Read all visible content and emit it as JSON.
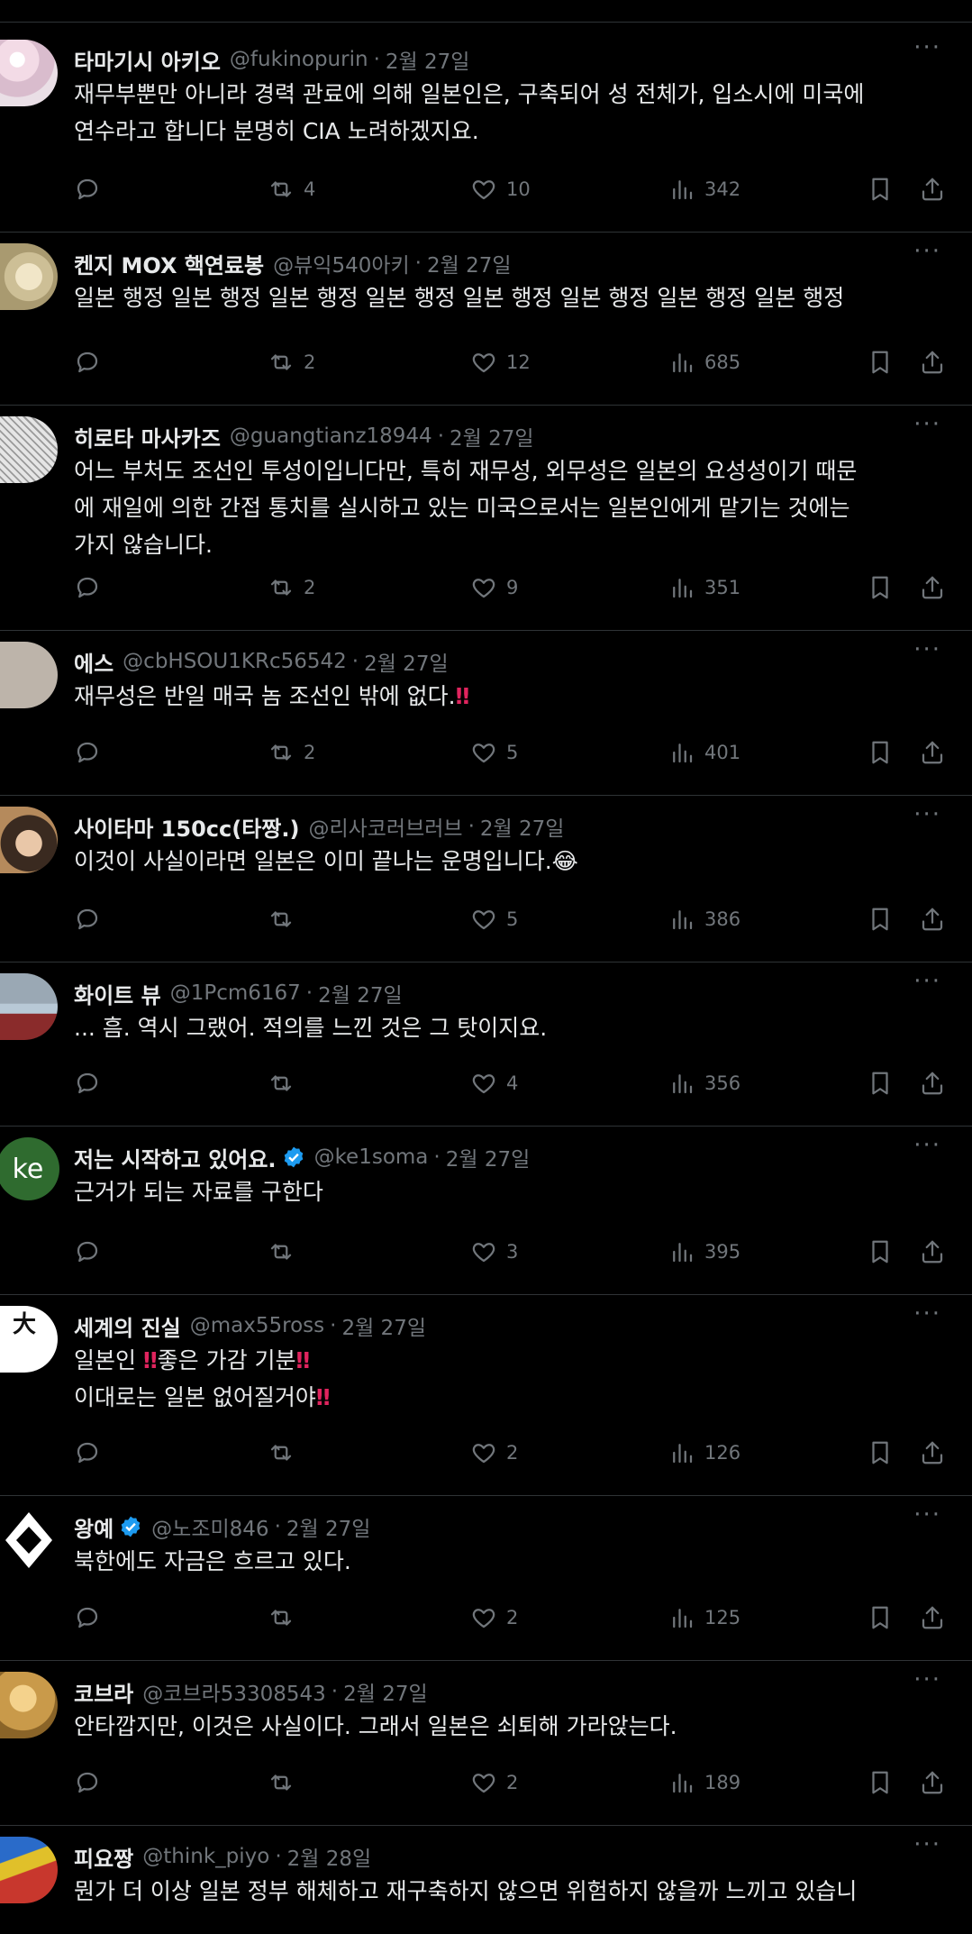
{
  "tweets": [
    {
      "name": "타마기시 아키오",
      "handle": "@fukinopurin",
      "date": "2월 27일",
      "verified": false,
      "lines": [
        "재무부뿐만 아니라 경력 관료에 의해 일본인은, 구축되어 성 전체가, 입소시에 미국에",
        "연수라고 합니다 분명히 CIA 노려하겠지요."
      ],
      "replies": "",
      "retweets": "4",
      "likes": "10",
      "views": "342",
      "avatar": {
        "type": "blossom",
        "color": "#e8d6df"
      }
    },
    {
      "name": "켄지 MOX 핵연료봉",
      "handle": "@뷰익540아키",
      "date": "2월 27일",
      "verified": false,
      "lines": [
        "일본 행정 일본 행정 일본 행정 일본 행정 일본 행정 일본 행정 일본 행정 일본 행정"
      ],
      "replies": "",
      "retweets": "2",
      "likes": "12",
      "views": "685",
      "avatar": {
        "type": "food",
        "color": "#d9cdb0"
      }
    },
    {
      "name": "히로타 마사카즈",
      "handle": "@guangtianz18944",
      "date": "2월 27일",
      "verified": false,
      "lines": [
        "어느 부처도 조선인 투성이입니다만, 특히 재무성, 외무성은 일본의 요성성이기 때문",
        "에 재일에 의한 간접 통치를 실시하고 있는 미국으로서는 일본인에게 맡기는 것에는",
        "가지 않습니다."
      ],
      "replies": "",
      "retweets": "2",
      "likes": "9",
      "views": "351",
      "avatar": {
        "type": "sketch",
        "color": "#cfcfcf"
      }
    },
    {
      "name": "에스",
      "handle": "@cbHSOU1KRc56542",
      "date": "2월 27일",
      "verified": false,
      "lines": [
        "재무성은 반일 매국 놈 조선인 밖에 없다.‼"
      ],
      "replies": "",
      "retweets": "2",
      "likes": "5",
      "views": "401",
      "avatar": {
        "type": "plain",
        "color": "#bdb7b0"
      }
    },
    {
      "name": "사이타마 150cc(타짱.)",
      "handle": "@리사코러브러브",
      "date": "2월 27일",
      "verified": false,
      "lines": [
        "이것이 사실이라면 일본은 이미 끝나는 운명입니다.😂"
      ],
      "replies": "",
      "retweets": "",
      "likes": "5",
      "views": "386",
      "avatar": {
        "type": "face",
        "color": "#6b5545"
      }
    },
    {
      "name": "화이트 뷰",
      "handle": "@1Pcm6167",
      "date": "2월 27일",
      "verified": false,
      "lines": [
        "... 흠. 역시 그랬어. 적의를 느낀 것은 그 탓이지요."
      ],
      "replies": "",
      "retweets": "",
      "likes": "4",
      "views": "356",
      "avatar": {
        "type": "bird",
        "color": "#8b3a3a"
      }
    },
    {
      "name": "저는 시작하고 있어요.",
      "handle": "@ke1soma",
      "date": "2월 27일",
      "verified": true,
      "lines": [
        "근거가 되는 자료를 구한다"
      ],
      "replies": "",
      "retweets": "",
      "likes": "3",
      "views": "395",
      "avatar": {
        "type": "initials",
        "color": "#2f6b2f",
        "text": "ke"
      }
    },
    {
      "name": "세계의 진실",
      "handle": "@max55ross",
      "date": "2월 27일",
      "verified": false,
      "lines": [
        "일본인 ‼좋은 가감 기분‼",
        "이대로는 일본 없어질거야‼"
      ],
      "replies": "",
      "retweets": "",
      "likes": "2",
      "views": "126",
      "avatar": {
        "type": "calligraphy",
        "color": "#ffffff"
      }
    },
    {
      "name": "왕예",
      "handle": "@노조미846",
      "date": "2월 27일",
      "verified": true,
      "lines": [
        "북한에도 자금은 흐르고 있다."
      ],
      "replies": "",
      "retweets": "",
      "likes": "2",
      "views": "125",
      "avatar": {
        "type": "emblem",
        "color": "#ffffff"
      }
    },
    {
      "name": "코브라",
      "handle": "@코브라53308543",
      "date": "2월 27일",
      "verified": false,
      "lines": [
        "안타깝지만, 이것은 사실이다. 그래서 일본은 쇠퇴해 가라앉는다."
      ],
      "replies": "",
      "retweets": "",
      "likes": "2",
      "views": "189",
      "avatar": {
        "type": "gold",
        "color": "#c99a4a"
      }
    },
    {
      "name": "피요짱",
      "handle": "@think_piyo",
      "date": "2월 28일",
      "verified": false,
      "lines": [
        "뭔가 더 이상 일본 정부 해체하고 재구축하지 않으면 위험하지 않을까 느끼고 있습니"
      ],
      "replies": "",
      "retweets": "",
      "likes": "",
      "views": "",
      "avatar": {
        "type": "parrot",
        "color": "#c8372d"
      }
    }
  ],
  "icons": {
    "reply": "reply-icon",
    "retweet": "retweet-icon",
    "like": "heart-icon",
    "views": "views-icon",
    "bookmark": "bookmark-icon",
    "share": "share-icon",
    "more": "more-icon",
    "verified": "verified-badge-icon"
  },
  "colors": {
    "background": "#000000",
    "text": "#e7e9ea",
    "muted": "#71767b",
    "verified": "#1d9bf0",
    "emphasis": "#e0245e"
  }
}
